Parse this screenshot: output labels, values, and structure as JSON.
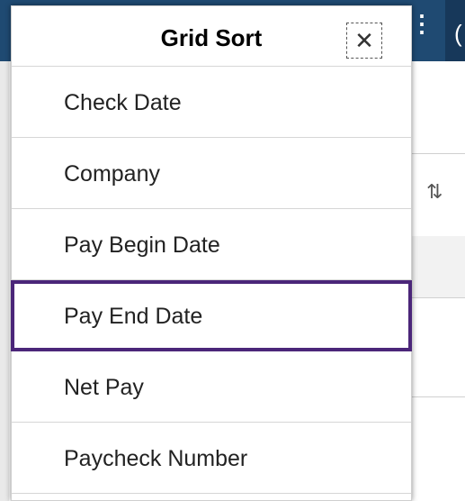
{
  "popup": {
    "title": "Grid Sort",
    "close_glyph": "✕",
    "items": [
      {
        "label": "Check Date",
        "selected": false
      },
      {
        "label": "Company",
        "selected": false
      },
      {
        "label": "Pay Begin Date",
        "selected": false
      },
      {
        "label": "Pay End Date",
        "selected": true
      },
      {
        "label": "Net Pay",
        "selected": false
      },
      {
        "label": "Paycheck Number",
        "selected": false
      }
    ]
  },
  "background": {
    "sort_icon_glyph": "⇅",
    "header_color": "#1f4a72"
  },
  "colors": {
    "selection_border": "#4b2679",
    "divider": "#d6d6d6"
  },
  "icons": {
    "close": "close-icon",
    "sort": "sort-icon",
    "kebab": "kebab-menu-icon"
  }
}
